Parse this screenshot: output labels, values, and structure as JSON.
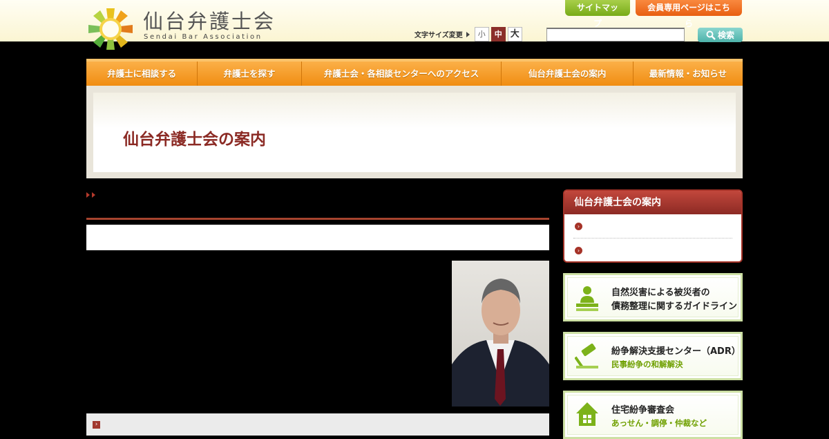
{
  "header": {
    "logo_jp": "仙台弁護士会",
    "logo_en": "Sendai Bar Association",
    "sitemap_label": "サイトマップ",
    "member_label": "会員専用ページはこちら",
    "fontsize_label": "文字サイズ変更",
    "fontsize_small": "小",
    "fontsize_medium": "中",
    "fontsize_large": "大",
    "search_button": "検索",
    "search_value": ""
  },
  "nav": {
    "items": [
      "弁護士に相談する",
      "弁護士を探す",
      "弁護士会・各相談センターへのアクセス",
      "仙台弁護士会の案内",
      "最新情報・お知らせ"
    ]
  },
  "page": {
    "title": "仙台弁護士会の案内"
  },
  "sidebar": {
    "menu_title": "仙台弁護士会の案内",
    "banners": [
      {
        "line1": "自然災害による被災者の",
        "line2": "債務整理に関するガイドライン",
        "icon": "person-desk-icon"
      },
      {
        "line1": "紛争解決支援センター（ADR）",
        "line2": "民事紛争の和解解決",
        "icon": "gavel-icon"
      },
      {
        "line1": "住宅紛争審査会",
        "line2": "あっせん・調停・仲裁など",
        "icon": "house-icon"
      }
    ]
  },
  "colors": {
    "accent_orange": "#f08c10",
    "accent_red": "#8b2a24",
    "accent_green": "#78ab18",
    "accent_teal": "#4db2aa"
  }
}
